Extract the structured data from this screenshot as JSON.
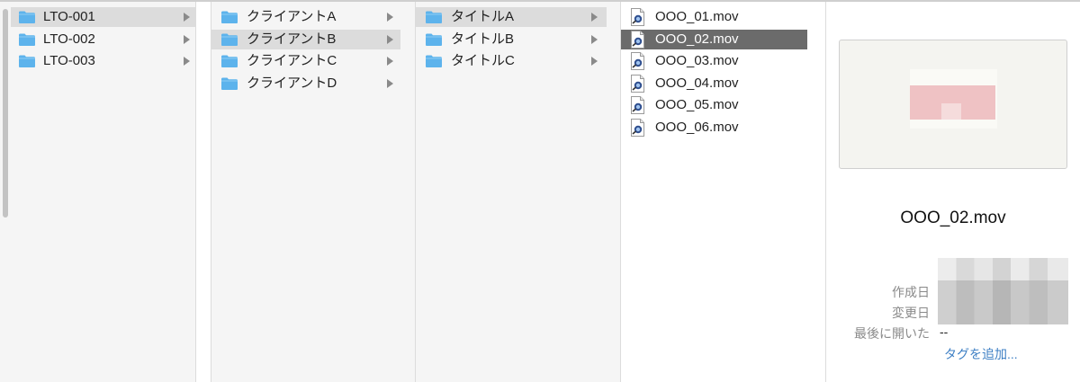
{
  "columns": [
    {
      "items": [
        {
          "label": "LTO-001",
          "icon": "folder-icon",
          "has_children": true,
          "selected": "gray"
        },
        {
          "label": "LTO-002",
          "icon": "folder-icon",
          "has_children": true,
          "selected": "none"
        },
        {
          "label": "LTO-003",
          "icon": "folder-icon",
          "has_children": true,
          "selected": "none"
        }
      ]
    },
    {
      "items": [
        {
          "label": "クライアントA",
          "icon": "folder-icon",
          "has_children": true,
          "selected": "none"
        },
        {
          "label": "クライアントB",
          "icon": "folder-icon",
          "has_children": true,
          "selected": "gray"
        },
        {
          "label": "クライアントC",
          "icon": "folder-icon",
          "has_children": true,
          "selected": "none"
        },
        {
          "label": "クライアントD",
          "icon": "folder-icon",
          "has_children": true,
          "selected": "none"
        }
      ]
    },
    {
      "items": [
        {
          "label": "タイトルA",
          "icon": "folder-icon",
          "has_children": true,
          "selected": "gray"
        },
        {
          "label": "タイトルB",
          "icon": "folder-icon",
          "has_children": true,
          "selected": "none"
        },
        {
          "label": "タイトルC",
          "icon": "folder-icon",
          "has_children": true,
          "selected": "none"
        }
      ]
    },
    {
      "items": [
        {
          "label": "OOO_01.mov",
          "icon": "quicktime-movie-file-icon",
          "has_children": false,
          "selected": "none"
        },
        {
          "label": "OOO_02.mov",
          "icon": "quicktime-movie-file-icon",
          "has_children": false,
          "selected": "dark"
        },
        {
          "label": "OOO_03.mov",
          "icon": "quicktime-movie-file-icon",
          "has_children": false,
          "selected": "none"
        },
        {
          "label": "OOO_04.mov",
          "icon": "quicktime-movie-file-icon",
          "has_children": false,
          "selected": "none"
        },
        {
          "label": "OOO_05.mov",
          "icon": "quicktime-movie-file-icon",
          "has_children": false,
          "selected": "none"
        },
        {
          "label": "OOO_06.mov",
          "icon": "quicktime-movie-file-icon",
          "has_children": false,
          "selected": "none"
        }
      ]
    }
  ],
  "preview": {
    "file_name": "OOO_02.mov",
    "created_label": "作成日",
    "modified_label": "変更日",
    "last_opened_label": "最後に開いた",
    "last_opened_value": "--",
    "add_tags_link": "タグを追加..."
  },
  "colors": {
    "folder": "#5db3ec",
    "selected_gray": "#dcdcdc",
    "selected_dark": "#6b6b6b",
    "link": "#3d7fc4"
  }
}
